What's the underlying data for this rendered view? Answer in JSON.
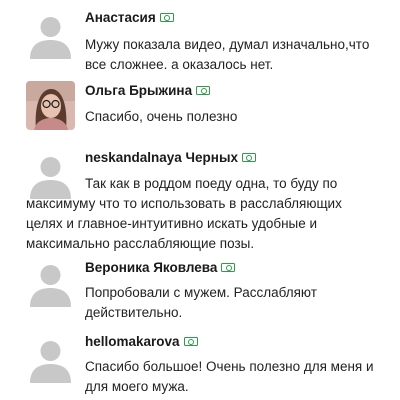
{
  "comments": [
    {
      "author": "Анастасия",
      "text": "Мужу показала видео, думал изначально,что все сложнее. а оказалось нет.",
      "avatar": "default-avatar-icon"
    },
    {
      "author": "Ольга Брыжина",
      "text": "Спасибо, очень полезно",
      "avatar": "user-photo"
    },
    {
      "author": "neskandalnaya Черных",
      "text": "Так как в роддом поеду одна, то буду по максимуму что то использовать в расслабляющих целях и главное-интуитивно искать удобные и максимально расслабляющие позы.",
      "avatar": "default-avatar-icon"
    },
    {
      "author": "Вероника Яковлева",
      "text": "Попробовали с мужем. Расслабляют действительно.",
      "avatar": "default-avatar-icon"
    },
    {
      "author": "hellomakarova",
      "text": "Спасибо большое! Очень полезно для меня и для моего мужа.",
      "avatar": "default-avatar-icon"
    }
  ],
  "badge_icon": "banknote-icon",
  "colors": {
    "badge": "#2e9b4a",
    "avatar_placeholder": "#c8c8c8"
  }
}
